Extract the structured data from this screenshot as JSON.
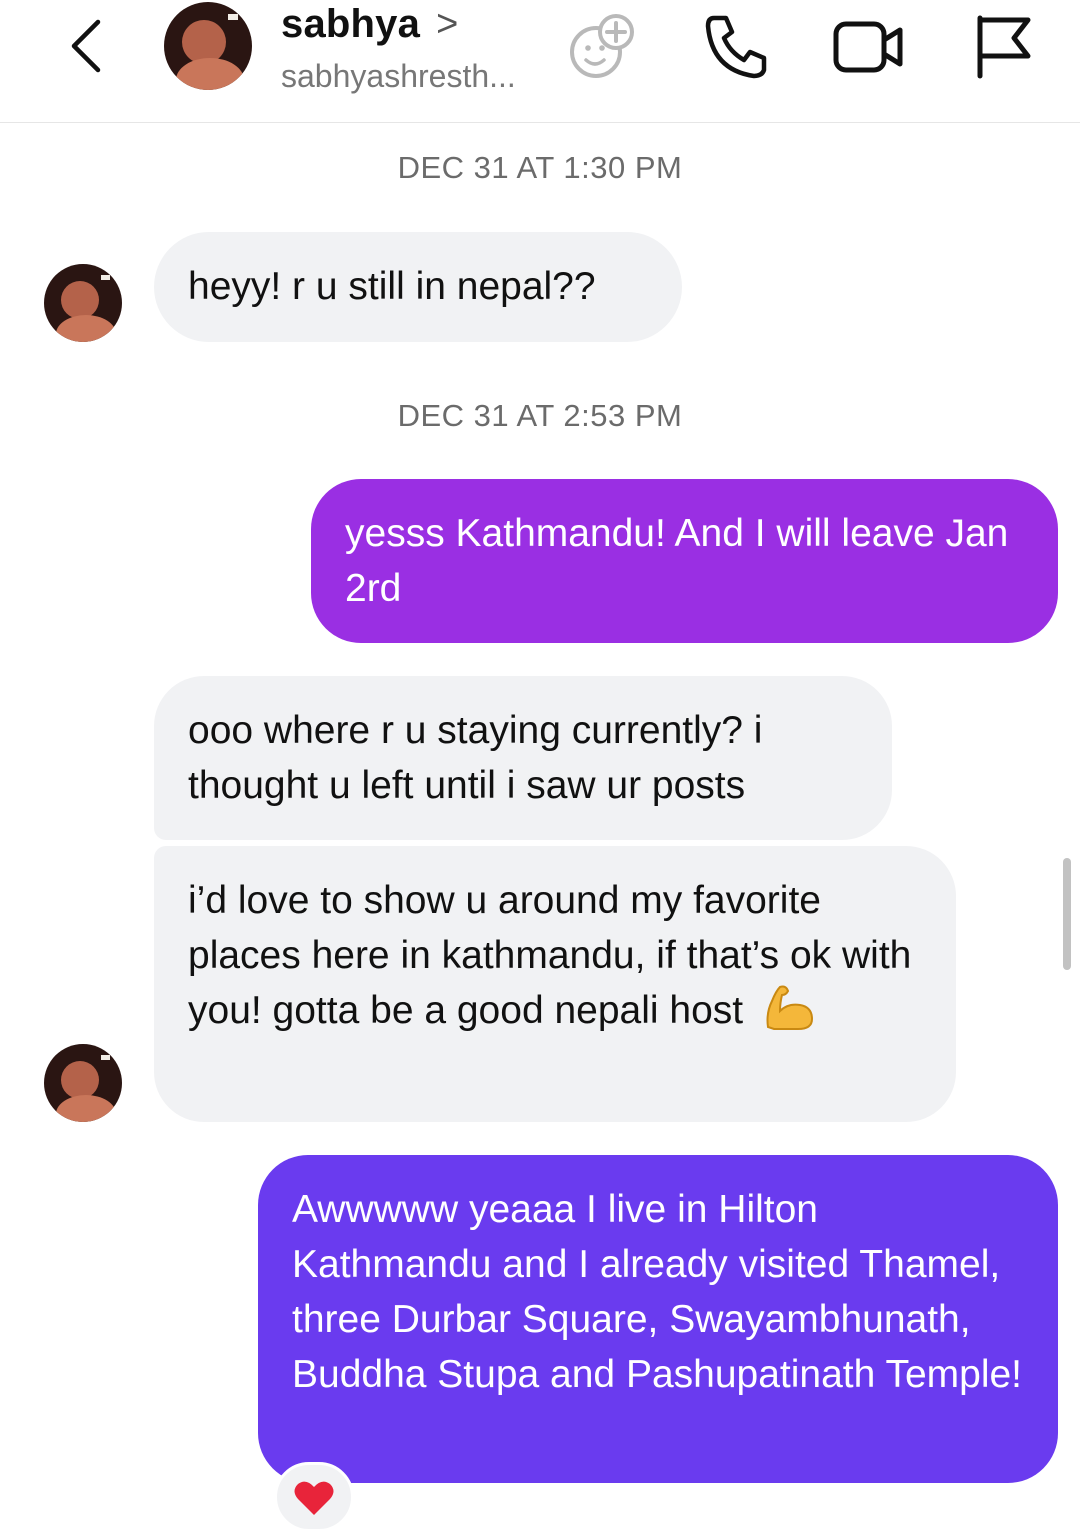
{
  "header": {
    "name": "sabhya",
    "handle": "sabhyashresth..."
  },
  "icons": {
    "back": "chevron-left-icon",
    "add_person": "add-person-icon",
    "call": "phone-icon",
    "video": "video-camera-icon",
    "report": "flag-icon",
    "reaction": "heart-emoji",
    "flex": "flexed-biceps-emoji"
  },
  "colors": {
    "outgoing_1": "#9a2fe3",
    "outgoing_2": "#6a3bef",
    "incoming": "#f1f2f4"
  },
  "messages": [
    {
      "timestamp": "DEC 31 AT 1:30 PM"
    },
    {
      "from": "sabhya",
      "text": "heyy! r u still in nepal??"
    },
    {
      "timestamp": "DEC 31 AT 2:53 PM"
    },
    {
      "from": "me",
      "text": "yesss Kathmandu! And I will leave Jan 2rd"
    },
    {
      "from": "sabhya",
      "text": "ooo where r u staying currently? i thought u left until i saw ur posts"
    },
    {
      "from": "sabhya",
      "text": "i’d love to show u around my favorite places here in kathmandu, if that’s ok with you! gotta be a good nepali host"
    },
    {
      "from": "me",
      "text": "Awwwww yeaaa I live in Hilton Kathmandu and I already visited Thamel, three Durbar Square, Swayambhunath, Buddha Stupa and Pashupatinath Temple!"
    }
  ]
}
